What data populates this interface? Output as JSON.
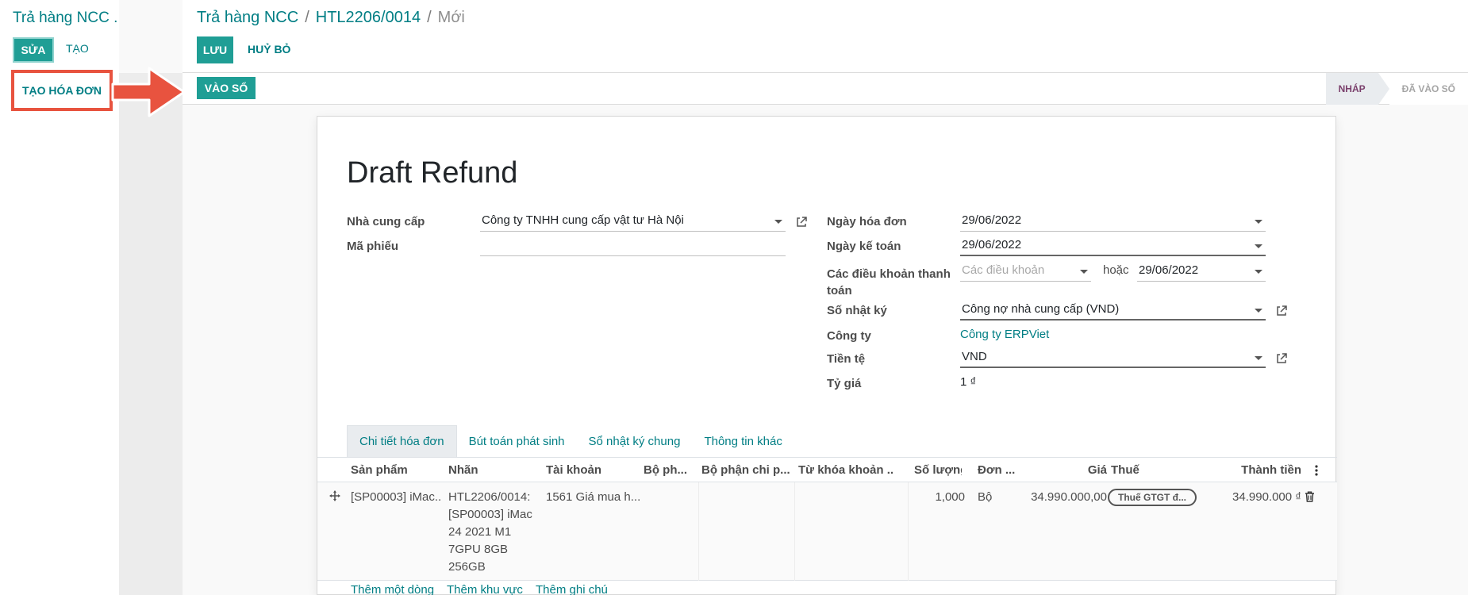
{
  "left": {
    "title": "Trả hàng NCC .",
    "edit_label": "SỬA",
    "create_label": "TẠO",
    "create_invoice_label": "TẠO HÓA ĐƠN"
  },
  "breadcrumb": {
    "root": "Trả hàng NCC",
    "sep1": "/",
    "record": "HTL2206/0014",
    "sep2": "/",
    "current": "Mới"
  },
  "toolbar": {
    "save_label": "LƯU",
    "discard_label": "HUỶ BỎ",
    "post_label": "VÀO SỔ"
  },
  "statusbar": {
    "draft": "NHÁP",
    "posted": "ĐÃ VÀO SỔ"
  },
  "form": {
    "title": "Draft Refund",
    "vendor_label": "Nhà cung cấp",
    "vendor_value": "Công ty TNHH cung cấp vật tư Hà Nội",
    "ref_label": "Mã phiếu",
    "ref_value": "",
    "invoice_date_label": "Ngày hóa đơn",
    "invoice_date_value": "29/06/2022",
    "accounting_date_label": "Ngày kế toán",
    "accounting_date_value": "29/06/2022",
    "payment_terms_label": "Các điều khoản thanh toán",
    "payment_terms_placeholder": "Các điều khoản",
    "or_label": "hoặc",
    "due_date_value": "29/06/2022",
    "journal_label": "Số nhật ký",
    "journal_value": "Công nợ nhà cung cấp (VND)",
    "company_label": "Công ty",
    "company_value": "Công ty ERPViet",
    "currency_label": "Tiền tệ",
    "currency_value": "VND",
    "rate_label": "Tỷ giá",
    "rate_value": "1 ₫"
  },
  "tabs": [
    "Chi tiết hóa đơn",
    "Bút toán phát sinh",
    "Sổ nhật ký chung",
    "Thông tin khác"
  ],
  "table": {
    "headers": [
      "Sản phẩm",
      "Nhãn",
      "Tài khoản",
      "Bộ ph...",
      "Bộ phận chi p...",
      "Từ khóa khoản ...",
      "Số lượng",
      "Đơn ...",
      "Giá",
      "Thuế",
      "Thành tiền"
    ],
    "row": {
      "product": "[SP00003] iMac...",
      "label": "HTL2206/0014: [SP00003] iMac 24 2021 M1 7GPU 8GB 256GB",
      "account": "1561 Giá mua h...",
      "quantity": "1,000",
      "uom": "Bộ",
      "price": "34.990.000,00",
      "tax": "Thuế GTGT đ...",
      "subtotal": "34.990.000 ₫"
    },
    "add_line": "Thêm một dòng",
    "add_section": "Thêm khu vực",
    "add_note": "Thêm ghi chú"
  },
  "colors": {
    "primary": "#1f9e95",
    "link": "#017e84",
    "arrow": "#e8533f"
  }
}
